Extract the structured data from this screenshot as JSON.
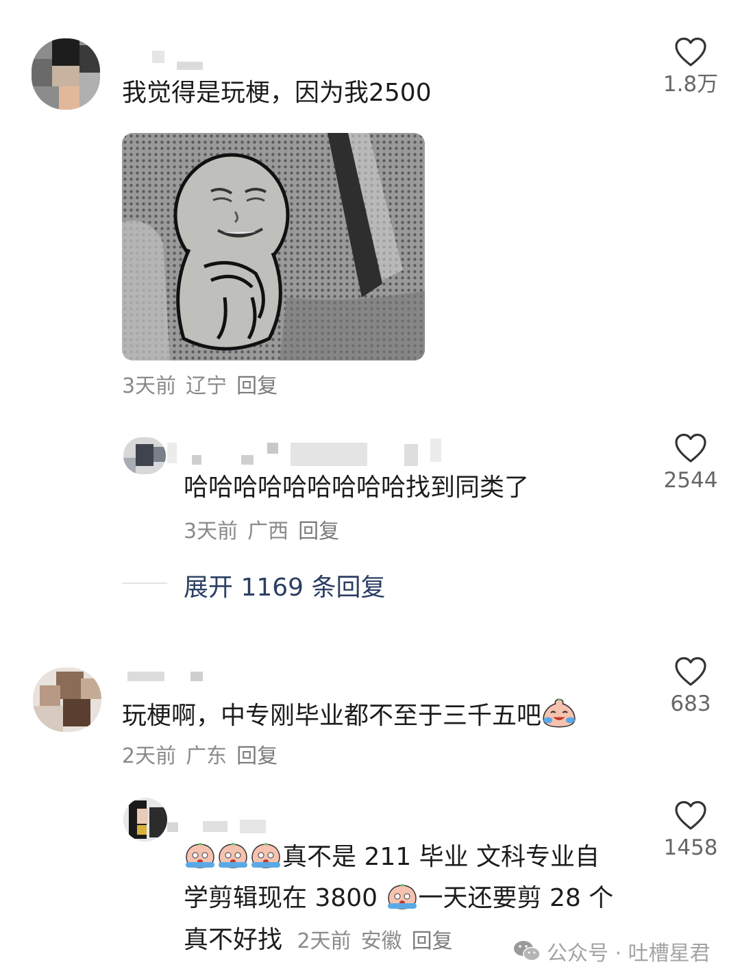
{
  "comments": [
    {
      "text": "我觉得是玩梗，因为我2500",
      "time": "3天前",
      "location": "辽宁",
      "reply_label": "回复",
      "likes": "1.8万",
      "replies": [
        {
          "text": "哈哈哈哈哈哈哈哈哈找到同类了",
          "time": "3天前",
          "location": "广西",
          "reply_label": "回复",
          "likes": "2544"
        }
      ],
      "expand_label": "展开 1169 条回复"
    },
    {
      "text": "玩梗啊，中专刚毕业都不至于三千五吧",
      "time": "2天前",
      "location": "广东",
      "reply_label": "回复",
      "likes": "683",
      "replies": [
        {
          "line1": "真不是 211 毕业 文科专业自",
          "line2a": "学剪辑现在 3800 ",
          "line2b": "一天还要剪 28 个",
          "line3": "真不好找",
          "time": "2天前",
          "location": "安徽",
          "reply_label": "回复",
          "likes": "1458"
        }
      ]
    }
  ],
  "watermark": "公众号 · 吐槽星君",
  "icons": [
    "heart-outline-icon",
    "laugh-cry-emoji",
    "crying-emoji",
    "wechat-icon"
  ]
}
